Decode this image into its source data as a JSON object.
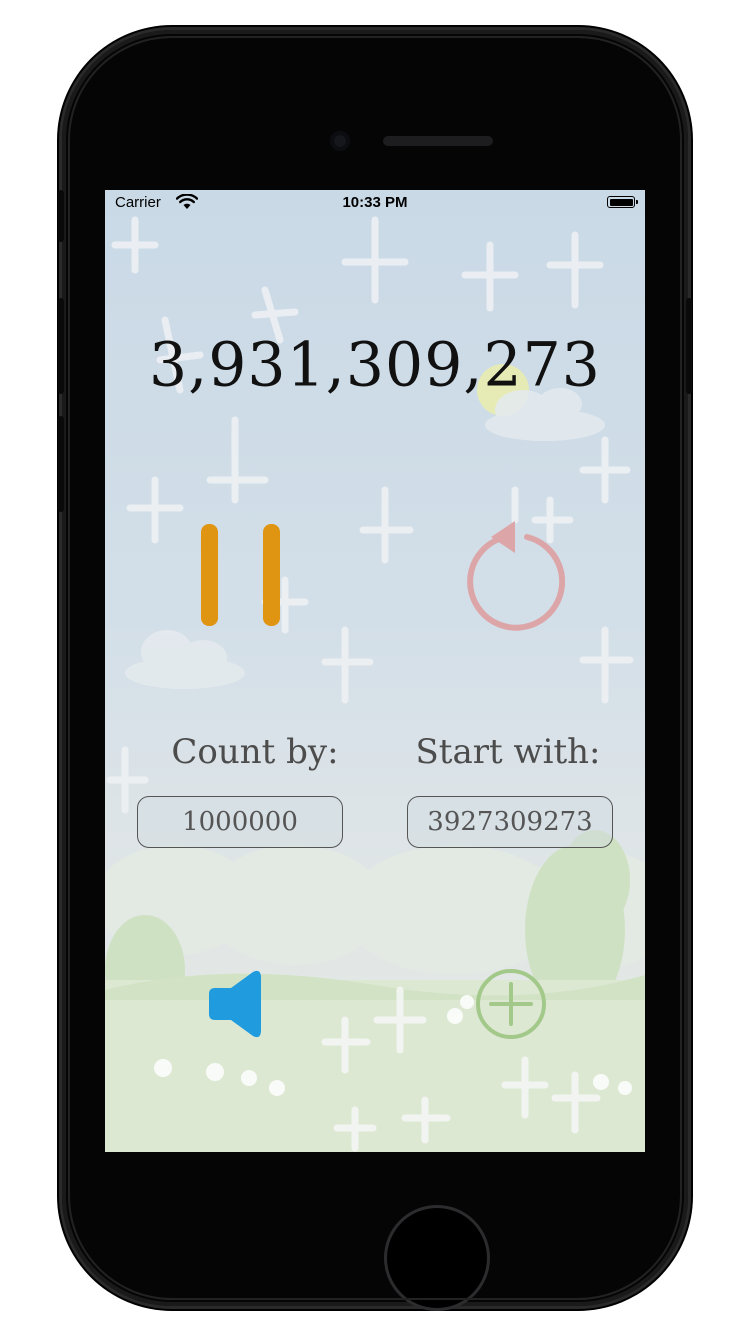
{
  "status_bar": {
    "carrier": "Carrier",
    "time": "10:33 PM",
    "wifi_icon": "wifi-icon",
    "battery_icon": "battery-icon"
  },
  "counter": {
    "value": "3,931,309,273"
  },
  "controls": {
    "pause_icon": "pause-icon",
    "pause_color": "#e09512",
    "reset_icon": "reset-icon",
    "reset_color": "#dca6a9"
  },
  "count_by": {
    "label": "Count by:",
    "value": "1000000"
  },
  "start_with": {
    "label": "Start with:",
    "value": "3927309273"
  },
  "bottom": {
    "sound_icon": "speaker-icon",
    "sound_color": "#1f9bde",
    "add_icon": "plus-circle-icon",
    "add_color": "#a3c98a"
  }
}
